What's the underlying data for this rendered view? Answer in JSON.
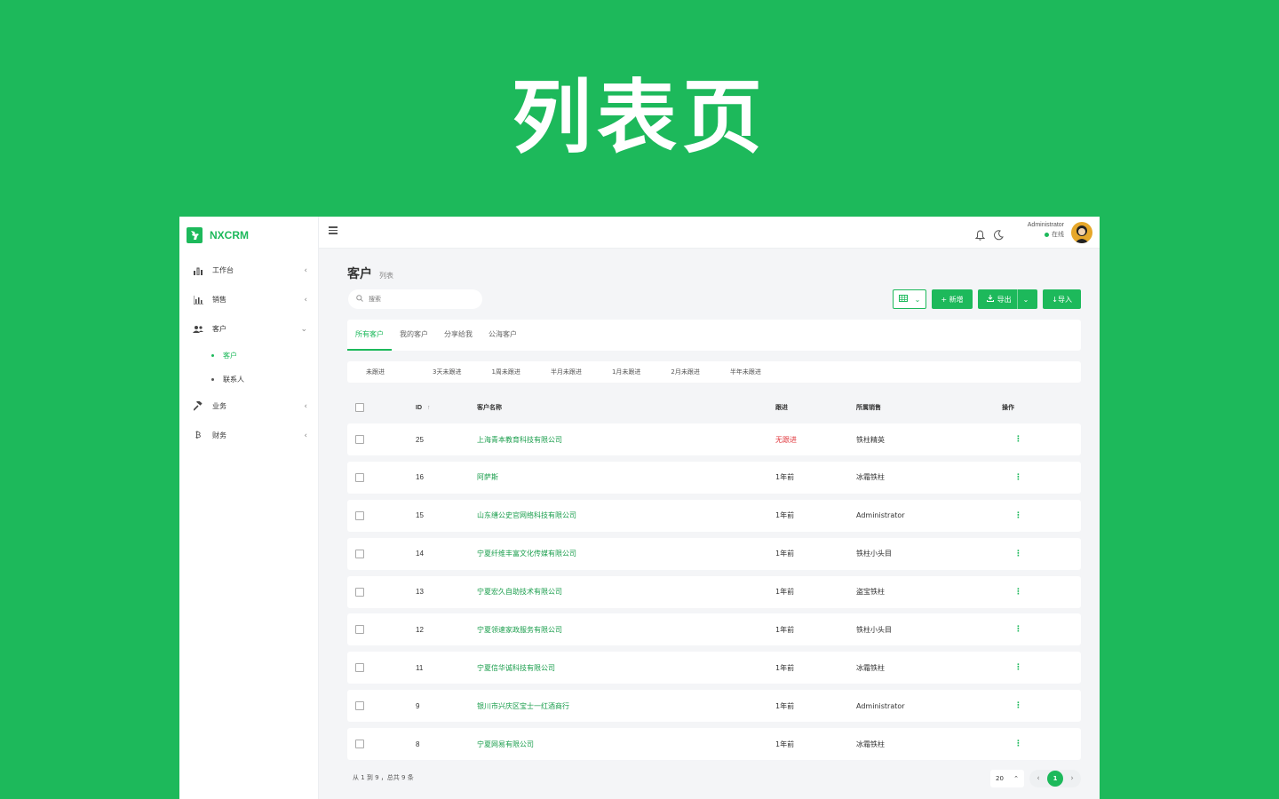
{
  "hero": {
    "title": "列表页"
  },
  "app": {
    "brand": "NXCRM",
    "sidebar": {
      "items": [
        {
          "label": "工作台",
          "icon": "dashboard-icon",
          "chevron": "‹"
        },
        {
          "label": "销售",
          "icon": "bar-chart-icon",
          "chevron": "‹"
        },
        {
          "label": "客户",
          "icon": "users-icon",
          "chevron": "⌄",
          "children": [
            {
              "label": "客户",
              "active": true
            },
            {
              "label": "联系人",
              "active": false
            }
          ]
        },
        {
          "label": "业务",
          "icon": "gavel-icon",
          "chevron": "‹"
        },
        {
          "label": "财务",
          "icon": "bitcoin-icon",
          "chevron": "‹"
        }
      ]
    },
    "topbar": {
      "user_name": "Administrator",
      "user_status": "在线"
    },
    "page": {
      "title": "客户",
      "subtitle": "列表",
      "search_placeholder": "搜索",
      "buttons": {
        "add": "+ 新增",
        "export": "导出",
        "import": "↓导入"
      },
      "tabs": [
        "所有客户",
        "我的客户",
        "分享给我",
        "公海客户"
      ],
      "filters": [
        "未跟进",
        "3天未跟进",
        "1周未跟进",
        "半月未跟进",
        "1月未跟进",
        "2月未跟进",
        "半年未跟进"
      ],
      "columns": {
        "id": "ID",
        "id_sort": "↑",
        "name": "客户名称",
        "follow": "跟进",
        "sales": "所属销售",
        "ops": "操作"
      },
      "rows": [
        {
          "id": "25",
          "name": "上海青本教育科技有限公司",
          "follow": "无跟进",
          "sales": "铁柱精英"
        },
        {
          "id": "16",
          "name": "阿萨斯",
          "follow": "1年前",
          "sales": "冰霜铁柱"
        },
        {
          "id": "15",
          "name": "山东缮公史官网络科技有限公司",
          "follow": "1年前",
          "sales": "Administrator"
        },
        {
          "id": "14",
          "name": "宁夏纤维丰富文化传媒有限公司",
          "follow": "1年前",
          "sales": "铁柱小头目"
        },
        {
          "id": "13",
          "name": "宁夏宏久自助技术有限公司",
          "follow": "1年前",
          "sales": "盗宝铁柱"
        },
        {
          "id": "12",
          "name": "宁夏领速家政服务有限公司",
          "follow": "1年前",
          "sales": "铁柱小头目"
        },
        {
          "id": "11",
          "name": "宁夏信华诚科技有限公司",
          "follow": "1年前",
          "sales": "冰霜铁柱"
        },
        {
          "id": "9",
          "name": "银川市兴庆区宝士一红酒商行",
          "follow": "1年前",
          "sales": "Administrator"
        },
        {
          "id": "8",
          "name": "宁夏网易有限公司",
          "follow": "1年前",
          "sales": "冰霜铁柱"
        }
      ],
      "row_action_glyph": "⋮",
      "footer": "从 1 到 9 ，总共 9 条",
      "pagination": {
        "page_size": "20",
        "current": "1",
        "prev": "‹",
        "next": "›"
      }
    },
    "colors": {
      "brand": "#1db95b",
      "danger": "#e0383e"
    }
  }
}
